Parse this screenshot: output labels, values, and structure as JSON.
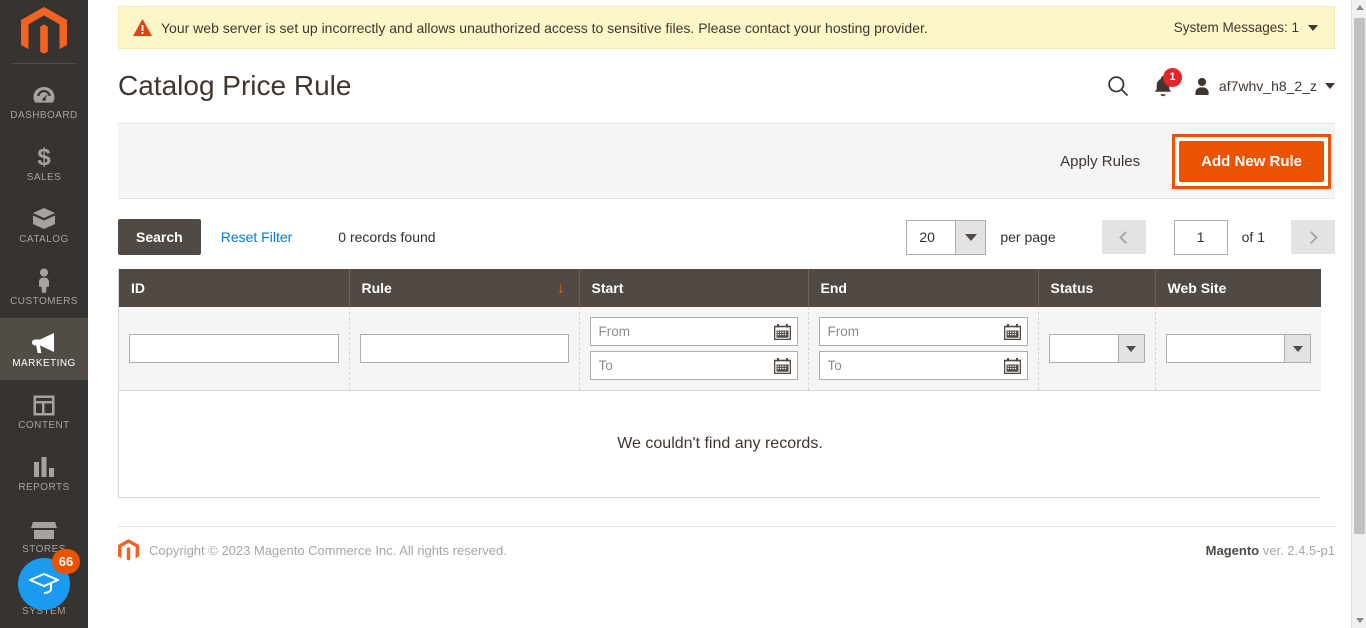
{
  "sidebar": {
    "logo_name": "magento-logo",
    "items": [
      {
        "label": "DASHBOARD",
        "icon": "dashboard-icon",
        "active": false
      },
      {
        "label": "SALES",
        "icon": "dollar-icon",
        "active": false
      },
      {
        "label": "CATALOG",
        "icon": "box-icon",
        "active": false
      },
      {
        "label": "CUSTOMERS",
        "icon": "person-icon",
        "active": false
      },
      {
        "label": "MARKETING",
        "icon": "megaphone-icon",
        "active": true
      },
      {
        "label": "CONTENT",
        "icon": "layout-icon",
        "active": false
      },
      {
        "label": "REPORTS",
        "icon": "bar-chart-icon",
        "active": false
      },
      {
        "label": "STORES",
        "icon": "store-icon",
        "active": false
      },
      {
        "label": "SYSTEM",
        "icon": "gear-icon",
        "active": false
      }
    ],
    "education_badge": "66",
    "education_icon": "graduation-cap-icon"
  },
  "message_banner": {
    "icon": "warning-triangle-icon",
    "text": "Your web server is set up incorrectly and allows unauthorized access to sensitive files. Please contact your hosting provider.",
    "toggle_label": "System Messages: 1",
    "toggle_icon": "chevron-down-icon",
    "background_color": "#fdf6c8",
    "icon_color": "#e1420e"
  },
  "header": {
    "title": "Catalog Price Rule",
    "search_icon": "search-icon",
    "notifications_icon": "bell-icon",
    "notifications_count": "1",
    "notifications_badge_color": "#e22626",
    "avatar_icon": "user-avatar-icon",
    "user_name": "af7whv_h8_2_z",
    "user_caret_icon": "caret-down-icon"
  },
  "page_actions": {
    "apply_rules_label": "Apply Rules",
    "add_new_rule_label": "Add New Rule",
    "primary_color": "#eb5202",
    "focus_ring_color": "#eb5202"
  },
  "grid_toolbar": {
    "search_label": "Search",
    "reset_filter_label": "Reset Filter",
    "records_found": "0 records found",
    "per_page_value": "20",
    "per_page_label": "per page",
    "prev_page_icon": "chevron-left-icon",
    "next_page_icon": "chevron-right-icon",
    "current_page": "1",
    "total_pages_label": "of 1"
  },
  "grid": {
    "columns": [
      {
        "label": "ID",
        "sorted": false,
        "sort_dir": ""
      },
      {
        "label": "Rule",
        "sorted": true,
        "sort_dir": "↓"
      },
      {
        "label": "Start",
        "sorted": false,
        "sort_dir": ""
      },
      {
        "label": "End",
        "sorted": false,
        "sort_dir": ""
      },
      {
        "label": "Status",
        "sorted": false,
        "sort_dir": ""
      },
      {
        "label": "Web Site",
        "sorted": false,
        "sort_dir": ""
      }
    ],
    "filters": {
      "id_value": "",
      "rule_value": "",
      "start_from_placeholder": "From",
      "start_to_placeholder": "To",
      "end_from_placeholder": "From",
      "end_to_placeholder": "To",
      "status_value": "",
      "website_value": "",
      "calendar_icon": "calendar-icon",
      "select_arrow_icon": "triangle-down-icon"
    },
    "empty_message": "We couldn't find any records.",
    "header_background": "#514943"
  },
  "footer": {
    "logo_icon": "magento-logo-icon",
    "copyright": "Copyright © 2023 Magento Commerce Inc. All rights reserved.",
    "version_brand": "Magento",
    "version_text": " ver. 2.4.5-p1"
  },
  "scrollbar": {
    "up_icon": "scroll-up-arrow-icon",
    "down_icon": "scroll-down-arrow-icon"
  }
}
